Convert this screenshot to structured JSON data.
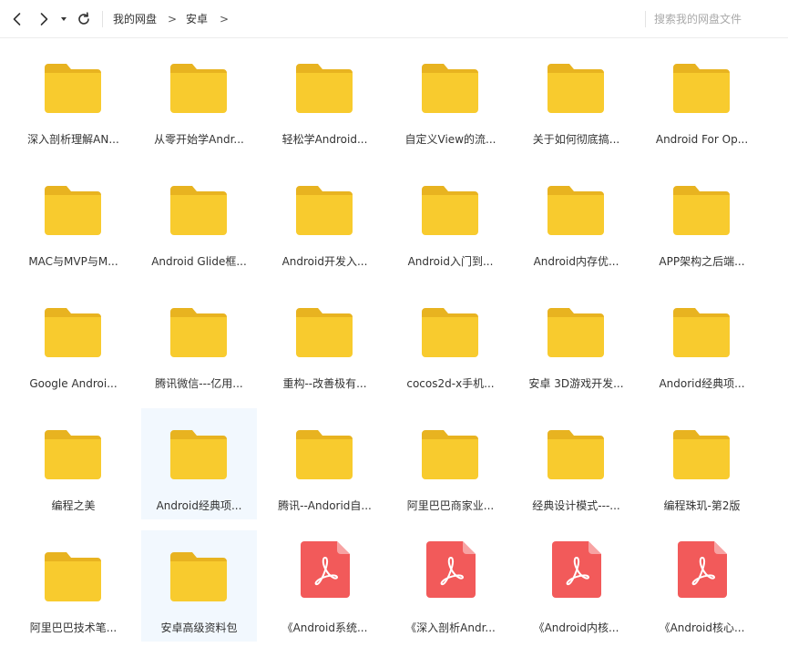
{
  "toolbar": {
    "back_icon": "chevron-left-icon",
    "forward_icon": "chevron-right-icon",
    "history_icon": "caret-down-icon",
    "refresh_icon": "refresh-icon",
    "search_placeholder": "搜索我的网盘文件"
  },
  "breadcrumb": [
    {
      "label": "我的网盘"
    },
    {
      "sep": ">"
    },
    {
      "label": "安卓"
    },
    {
      "sep": ">"
    }
  ],
  "colors": {
    "folder_body": "#F8CB2E",
    "folder_tab": "#E8B320",
    "pdf": "#F25A5A",
    "selected_bg": "#F2F8FE"
  },
  "files": [
    {
      "name": "深入剖析理解AN...",
      "type": "folder"
    },
    {
      "name": "从零开始学Andr...",
      "type": "folder"
    },
    {
      "name": "轻松学Android...",
      "type": "folder"
    },
    {
      "name": "自定义View的流...",
      "type": "folder"
    },
    {
      "name": "关于如何彻底搞...",
      "type": "folder"
    },
    {
      "name": "Android For Op...",
      "type": "folder"
    },
    {
      "name": "MAC与MVP与M...",
      "type": "folder"
    },
    {
      "name": "Android Glide框...",
      "type": "folder"
    },
    {
      "name": "Android开发入...",
      "type": "folder"
    },
    {
      "name": "Android入门到...",
      "type": "folder"
    },
    {
      "name": "Android内存优...",
      "type": "folder"
    },
    {
      "name": "APP架构之后端...",
      "type": "folder"
    },
    {
      "name": "Google Androi...",
      "type": "folder"
    },
    {
      "name": "腾讯微信---亿用...",
      "type": "folder"
    },
    {
      "name": "重构--改善极有...",
      "type": "folder"
    },
    {
      "name": "cocos2d-x手机...",
      "type": "folder"
    },
    {
      "name": "安卓 3D游戏开发...",
      "type": "folder"
    },
    {
      "name": "Andorid经典项...",
      "type": "folder"
    },
    {
      "name": "编程之美",
      "type": "folder"
    },
    {
      "name": "Android经典项...",
      "type": "folder",
      "selected": true
    },
    {
      "name": "腾讯--Andorid自...",
      "type": "folder"
    },
    {
      "name": "阿里巴巴商家业...",
      "type": "folder"
    },
    {
      "name": "经典设计模式---...",
      "type": "folder"
    },
    {
      "name": "编程珠玑-第2版",
      "type": "folder"
    },
    {
      "name": "阿里巴巴技术笔...",
      "type": "folder"
    },
    {
      "name": "安卓高级资料包",
      "type": "folder",
      "selected": true
    },
    {
      "name": "《Android系统...",
      "type": "pdf"
    },
    {
      "name": "《深入剖析Andr...",
      "type": "pdf"
    },
    {
      "name": "《Android内核...",
      "type": "pdf"
    },
    {
      "name": "《Android核心...",
      "type": "pdf"
    }
  ]
}
